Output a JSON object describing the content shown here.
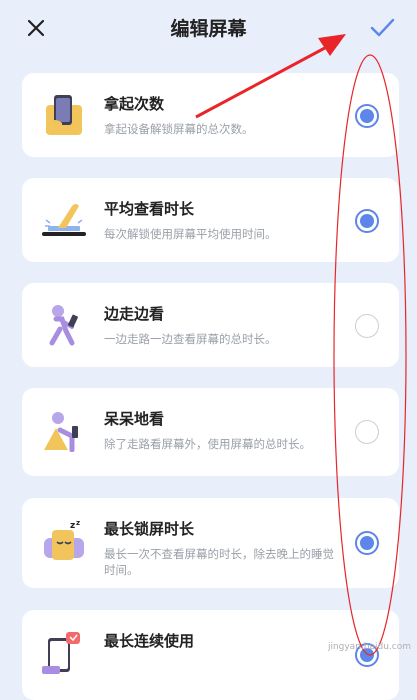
{
  "header": {
    "title": "编辑屏幕",
    "close_icon": "close-icon",
    "confirm_icon": "check-icon"
  },
  "items": [
    {
      "name": "拿起次数",
      "desc": "拿起设备解锁屏幕的总次数。",
      "checked": true
    },
    {
      "name": "平均查看时长",
      "desc": "每次解锁使用屏幕平均使用时间。",
      "checked": true
    },
    {
      "name": "边走边看",
      "desc": "一边走路一边查看屏幕的总时长。",
      "checked": false
    },
    {
      "name": "呆呆地看",
      "desc": "除了走路看屏幕外，使用屏幕的总时长。",
      "checked": false
    },
    {
      "name": "最长锁屏时长",
      "desc": "最长一次不查看屏幕的时长，除去晚上的睡觉时间。",
      "checked": true
    },
    {
      "name": "最长连续使用",
      "desc": "",
      "checked": true
    }
  ],
  "colors": {
    "accent": "#5c86e8",
    "background": "#e9eefb",
    "annotation": "#e8262a"
  }
}
